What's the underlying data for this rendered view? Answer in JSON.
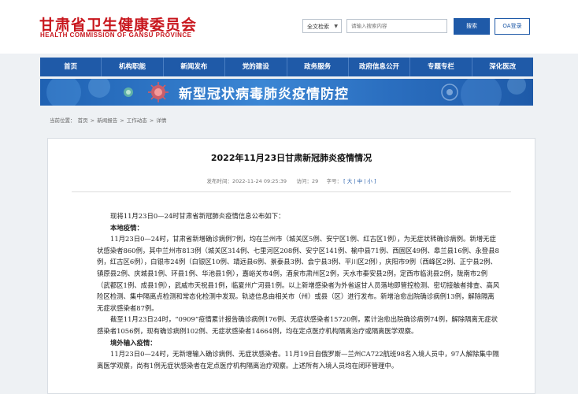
{
  "header": {
    "logo_cn": "甘肃省卫生健康委员会",
    "logo_en": "HEALTH COMMISSION OF GANSU PROVINCE",
    "search_scope": "全文检索",
    "search_placeholder": "请输入搜索内容",
    "search_button": "搜索",
    "oa_button": "OA登录"
  },
  "nav": {
    "items": [
      "首页",
      "机构职能",
      "新闻发布",
      "党的建设",
      "政务服务",
      "政府信息公开",
      "专题专栏",
      "深化医改"
    ]
  },
  "banner": {
    "title": "新型冠状病毒肺炎疫情防控"
  },
  "breadcrumb": {
    "label": "当前位置：",
    "items": [
      "首页",
      "新闻报告",
      "工作动态",
      "详情"
    ],
    "separator": ">"
  },
  "article": {
    "title": "2022年11月23日甘肃新冠肺炎疫情情况",
    "meta": {
      "published_label": "发布时间：",
      "published": "2022-11-24 09:25:39",
      "views_label": "访问：",
      "views": "29",
      "font_label": "字号：",
      "font_sizes": [
        "大",
        "中",
        "小"
      ]
    },
    "paragraphs": [
      {
        "text": "现将11月23日0—24时甘肃省新冠肺炎疫情信息公布如下：",
        "bold": false
      },
      {
        "text": "本地疫情：",
        "bold": true
      },
      {
        "text": "11月23日0—24时，甘肃省新增确诊病例7例，均在兰州市（城关区5例、安宁区1例、红古区1例），为无症状转确诊病例。新增无症状感染者860例，其中兰州市813例（城关区314例、七里河区208例、安宁区141例、榆中县71例、西固区49例、皋兰县16例、永登县8例，红古区6例），白银市24例（白银区10例、靖远县6例、景泰县3例、会宁县3例、平川区2例），庆阳市9例（西峰区2例、正宁县2例、镇原县2例、庆城县1例、环县1例、华池县1例），嘉峪关市4例，酒泉市肃州区2例，天水市秦安县2例，定西市临洮县2例，陇南市2例（武都区1例、成县1例），武威市天祝县1例，临夏州广河县1例。以上新增感染者为外省返甘人员落地即管控检测、密切接触者排查、高风险区检测、集中隔离点检测和常态化检测中发现。轨迹信息由相关市（州）或县（区）进行发布。新增治愈出院确诊病例13例，解除隔离无症状感染者87例。",
        "bold": false
      },
      {
        "text": "截至11月23日24时，“0909”疫情累计报告确诊病例176例、无症状感染者15720例，累计治愈出院确诊病例74例，解除隔离无症状感染者1056例，现有确诊病例102例、无症状感染者14664例，均在定点医疗机构隔离治疗或隔离医学观察。",
        "bold": false
      },
      {
        "text": "境外输入疫情：",
        "bold": true
      },
      {
        "text": "11月23日0—24时，无新增输入确诊病例、无症状感染者。11月19日自俄罗斯—兰州CA722航班98名入境人员中，97人解除集中隔离医学观察，尚有1例无症状感染者在定点医疗机构隔离治疗观察。上述所有入境人员均在闭环管理中。",
        "bold": false
      }
    ]
  },
  "colors": {
    "brand_red": "#c8161d",
    "nav_blue": "#1f5aa8"
  }
}
